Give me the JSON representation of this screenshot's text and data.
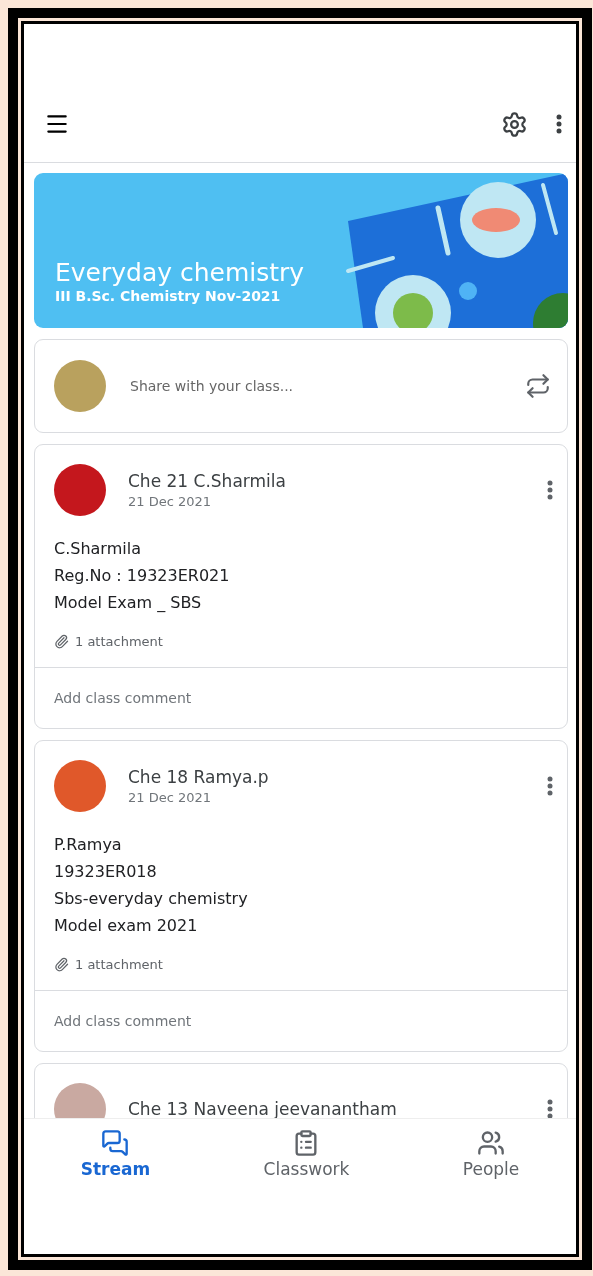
{
  "course": {
    "title": "Everyday chemistry",
    "subtitle": "III B.Sc. Chemistry Nov-2021"
  },
  "share": {
    "placeholder": "Share with your class..."
  },
  "posts": [
    {
      "author": "Che 21 C.Sharmila",
      "date": "21 Dec 2021",
      "lines": [
        "C.Sharmila",
        "Reg.No : 19323ER021",
        "Model Exam _ SBS"
      ],
      "attachment": "1 attachment",
      "comment_placeholder": "Add class comment"
    },
    {
      "author": "Che 18 Ramya.p",
      "date": "21 Dec 2021",
      "lines": [
        "P.Ramya",
        "19323ER018",
        "Sbs-everyday chemistry",
        "Model exam 2021"
      ],
      "attachment": "1 attachment",
      "comment_placeholder": "Add class comment"
    },
    {
      "author": "Che 13 Naveena jeevanantham"
    }
  ],
  "nav": [
    {
      "kind": "stream",
      "label": "Stream",
      "selected": true
    },
    {
      "kind": "classwork",
      "label": "Classwork",
      "selected": false
    },
    {
      "kind": "people",
      "label": "People",
      "selected": false
    }
  ]
}
